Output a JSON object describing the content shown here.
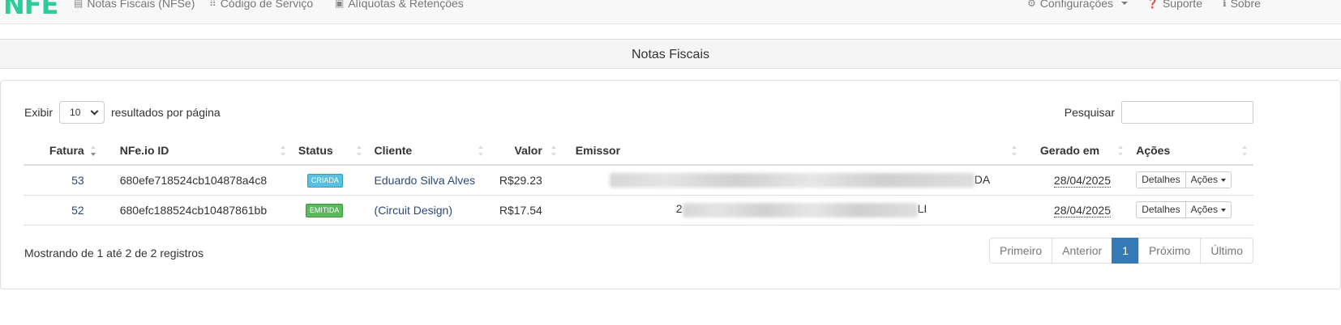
{
  "nav": {
    "logo": "NFE",
    "items": [
      {
        "label": "Notas Fiscais (NFSe)",
        "icon": "list-icon"
      },
      {
        "label": "Código de Serviço",
        "icon": "grid-icon"
      },
      {
        "label": "Alíquotas & Retenções",
        "icon": "calculator-icon"
      }
    ],
    "right": [
      {
        "label": "Configurações",
        "icon": "gear-icon"
      },
      {
        "label": "Suporte",
        "icon": "question-icon"
      },
      {
        "label": "Sobre",
        "icon": "info-icon"
      }
    ]
  },
  "panel": {
    "title": "Notas Fiscais"
  },
  "length": {
    "prefix": "Exibir",
    "value": "10",
    "suffix": "resultados por página"
  },
  "search": {
    "label": "Pesquisar",
    "value": ""
  },
  "table": {
    "columns": [
      "Fatura",
      "NFe.io ID",
      "Status",
      "Cliente",
      "Valor",
      "Emissor",
      "Gerado em",
      "Ações"
    ],
    "rows": [
      {
        "fatura": "53",
        "id": "680efe718524cb104878a4c8",
        "status": "CRIADA",
        "cliente": "Eduardo Silva Alves",
        "valor": "R$29.23",
        "emissor": "DA",
        "gerado": "28/04/2025",
        "detalhes": "Detalhes",
        "acoes": "Ações"
      },
      {
        "fatura": "52",
        "id": "680efc188524cb10487861bb",
        "status": "EMITIDA",
        "cliente": "(Circuit Design)",
        "valor": "R$17.54",
        "emissor_prefix": "2",
        "emissor": "LI",
        "gerado": "28/04/2025",
        "detalhes": "Detalhes",
        "acoes": "Ações"
      }
    ]
  },
  "info": "Mostrando de 1 até 2 de 2 registros",
  "pagination": {
    "first": "Primeiro",
    "prev": "Anterior",
    "current": "1",
    "next": "Próximo",
    "last": "Último"
  },
  "colors": {
    "logo": "#2ecc9a",
    "primary": "#337ab7",
    "info": "#5bc0de",
    "success": "#5cb85c"
  }
}
